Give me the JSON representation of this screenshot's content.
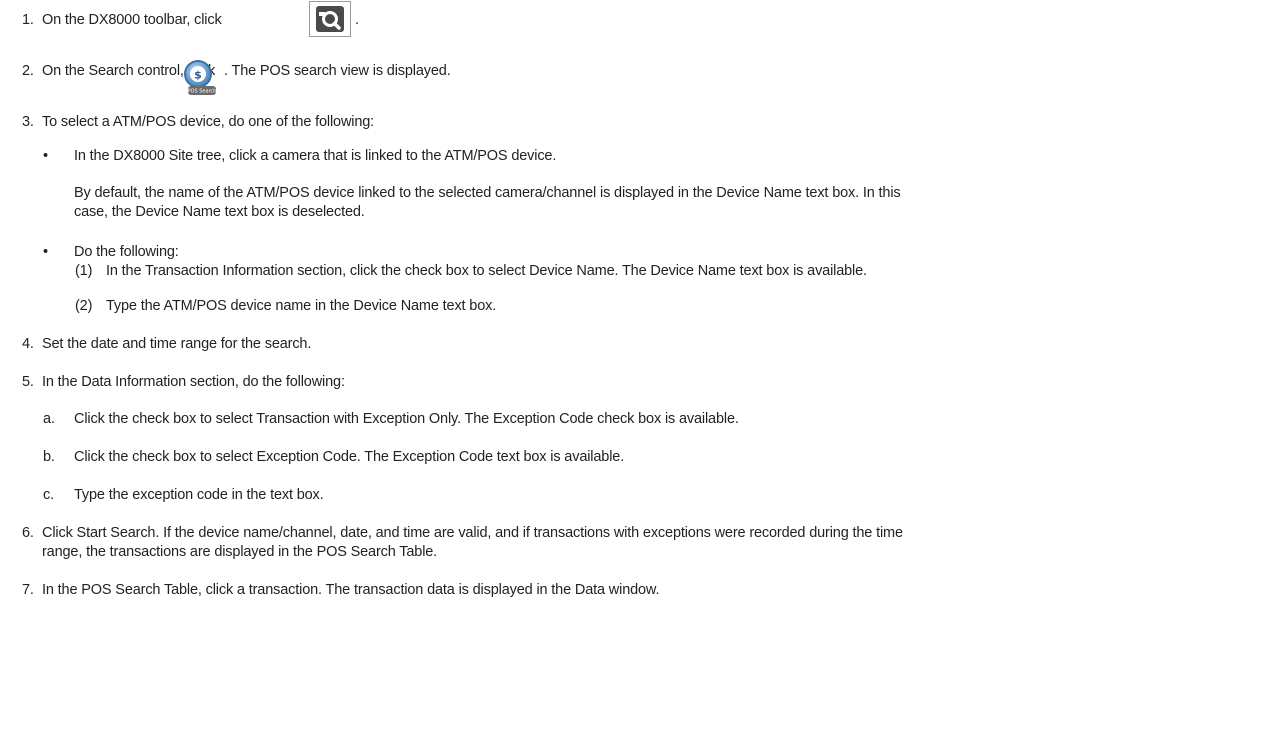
{
  "steps": [
    {
      "num": "1.",
      "text_before": "On the DX8000 toolbar, click",
      "text_after": "."
    },
    {
      "num": "2.",
      "text_before": "On the Search control, click",
      "text_after": ". The POS search view is displayed."
    },
    {
      "num": "3.",
      "text": "To select a ATM/POS device, do one of the following:"
    },
    {
      "num": "4.",
      "text": "Set the date and time range for the search."
    },
    {
      "num": "5.",
      "text": "In the Data Information section, do the following:"
    },
    {
      "num": "6.",
      "text_line1": "Click Start Search. If the device name/channel, date, and time are valid, and if transactions with exceptions were recorded during the time",
      "text_line2": "range, the transactions are displayed in the POS Search Table."
    },
    {
      "num": "7.",
      "text": "In the POS Search Table, click a transaction. The transaction data is displayed in the Data window."
    }
  ],
  "step3_bullets": [
    {
      "bullet": "•",
      "text": "In the DX8000 Site tree, click a camera that is linked to the ATM/POS device.",
      "note_line1": "By default, the name of the ATM/POS device linked to the selected camera/channel is displayed in the Device Name text box. In this",
      "note_line2": "case, the Device Name text box is deselected."
    },
    {
      "bullet": "•",
      "text": "Do the following:",
      "subitems": [
        {
          "num": "(1)",
          "text": "In the Transaction Information section, click the check box to select Device Name. The Device Name text box is available."
        },
        {
          "num": "(2)",
          "text": "Type the ATM/POS device name in the Device Name text box."
        }
      ]
    }
  ],
  "step5_items": [
    {
      "num": "a.",
      "text": "Click the check box to select Transaction with Exception Only. The Exception Code check box is available."
    },
    {
      "num": "b.",
      "text": "Click the check box to select Exception Code. The Exception Code text box is available."
    },
    {
      "num": "c.",
      "text": "Type the exception code in the text box."
    }
  ],
  "icons": {
    "toolbar_search": "search-icon",
    "pos_search": "pos-search-icon",
    "pos_search_label": "POS Search",
    "pos_symbol": "$"
  },
  "colors": {
    "text": "#222222",
    "icon_dark": "#4a4a4a",
    "pos_blue": "#5b9bd5"
  }
}
